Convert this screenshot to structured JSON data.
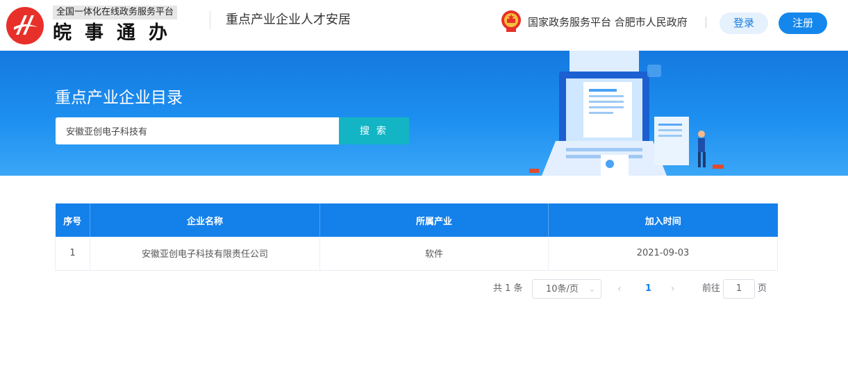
{
  "header": {
    "logo_subtitle": "全国一体化在线政务服务平台",
    "logo_name": "皖事通办",
    "portal_title": "重点产业企业人才安居",
    "gov_links": "国家政务服务平台 合肥市人民政府",
    "login_label": "登录",
    "register_label": "注册"
  },
  "banner": {
    "title": "重点产业企业目录",
    "search_value": "安徽亚创电子科技有",
    "search_button": "搜 索"
  },
  "table": {
    "columns": [
      "序号",
      "企业名称",
      "所属产业",
      "加入时间"
    ],
    "rows": [
      [
        "1",
        "安徽亚创电子科技有限责任公司",
        "软件",
        "2021-09-03"
      ]
    ]
  },
  "pagination": {
    "total": "共 1 条",
    "page_size": "10条/页",
    "current_page": "1",
    "goto_label": "前往",
    "goto_value": "1",
    "page_suffix": "页"
  },
  "colors": {
    "primary": "#1480ea",
    "search_button": "#13b5c5",
    "brand_red": "#e8302a"
  }
}
